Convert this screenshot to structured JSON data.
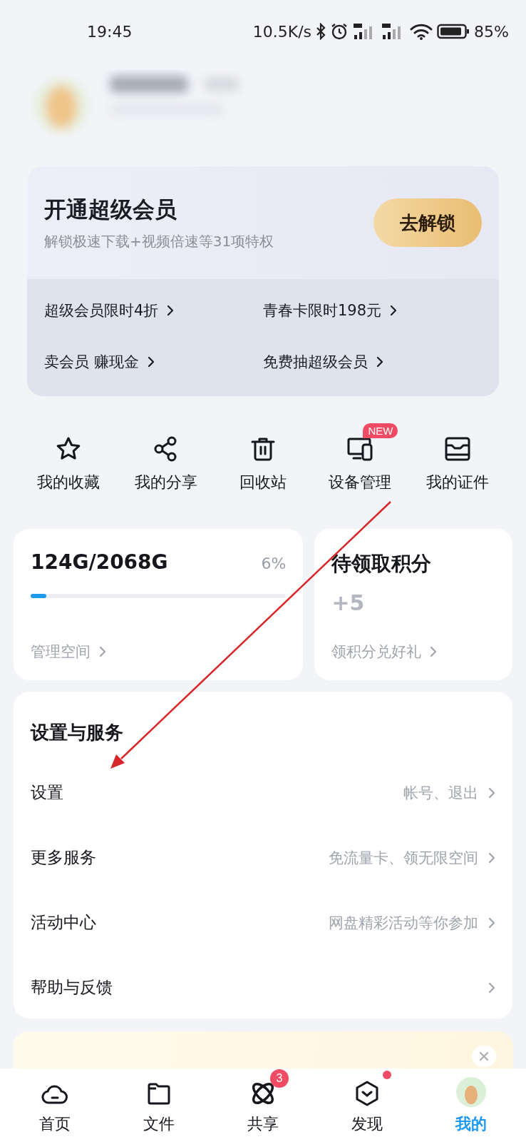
{
  "status_bar": {
    "time": "19:45",
    "net_speed": "10.5K/s",
    "battery": "85%"
  },
  "vip": {
    "title": "开通超级会员",
    "subtitle": "解锁极速下载+视频倍速等31项特权",
    "button": "去解锁",
    "links": [
      "超级会员限时4折",
      "青春卡限时198元",
      "卖会员 赚现金",
      "免费抽超级会员"
    ]
  },
  "shortcuts": [
    {
      "label": "我的收藏"
    },
    {
      "label": "我的分享"
    },
    {
      "label": "回收站"
    },
    {
      "label": "设备管理",
      "badge": "NEW"
    },
    {
      "label": "我的证件"
    }
  ],
  "storage": {
    "usage": "124G/2068G",
    "percent": "6%",
    "level": 0.06,
    "link": "管理空间"
  },
  "points": {
    "title": "待领取积分",
    "value": "+5",
    "link": "领积分兑好礼"
  },
  "services": {
    "title": "设置与服务",
    "items": [
      {
        "label": "设置",
        "hint": "帐号、退出"
      },
      {
        "label": "更多服务",
        "hint": "免流量卡、领无限空间"
      },
      {
        "label": "活动中心",
        "hint": "网盘精彩活动等你参加"
      },
      {
        "label": "帮助与反馈"
      }
    ]
  },
  "tabs": [
    {
      "label": "首页",
      "selected": false,
      "dot": false
    },
    {
      "label": "文件",
      "selected": false,
      "dot": false
    },
    {
      "label": "共享",
      "selected": false,
      "dot": false,
      "badge": "3"
    },
    {
      "label": "发现",
      "selected": false,
      "dot": true
    },
    {
      "label": "我的",
      "selected": true,
      "dot": false
    }
  ]
}
